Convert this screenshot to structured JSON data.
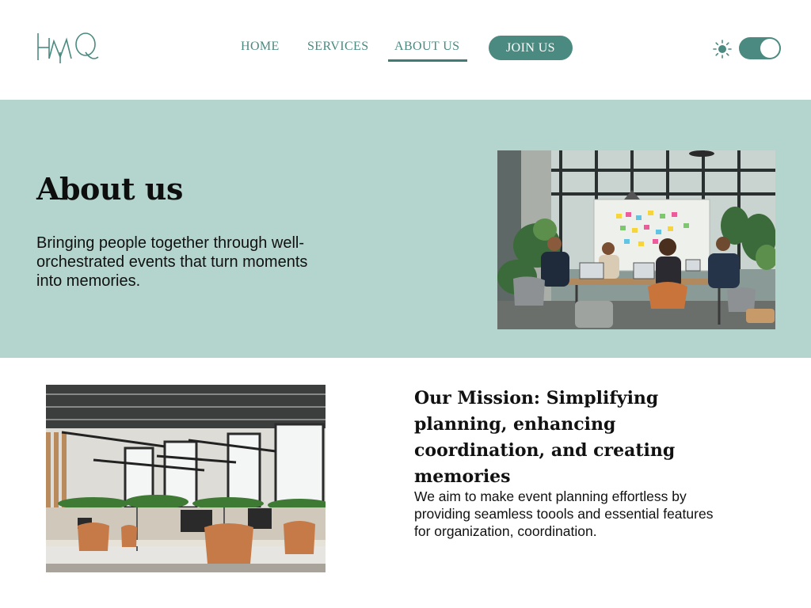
{
  "header": {
    "logo_text": "HMQ",
    "nav": {
      "home": "HOME",
      "services": "SERVICES",
      "about": "ABOUT US"
    },
    "join_label": "JOIN US",
    "theme_icon": "sun-icon",
    "theme_toggle_on": true
  },
  "hero": {
    "title": "About us",
    "text": "Bringing people together through well-orchestrated events that turn moments into memories."
  },
  "mission": {
    "title": "Our Mission: Simplifying planning, enhancing coordination, and creating memories",
    "text": "We aim to make event planning effortless by providing seamless toools and essential features for organization, coordination."
  },
  "colors": {
    "accent": "#4a8a80",
    "hero_bg": "#b3d5ce",
    "underline": "#3f7c74"
  }
}
